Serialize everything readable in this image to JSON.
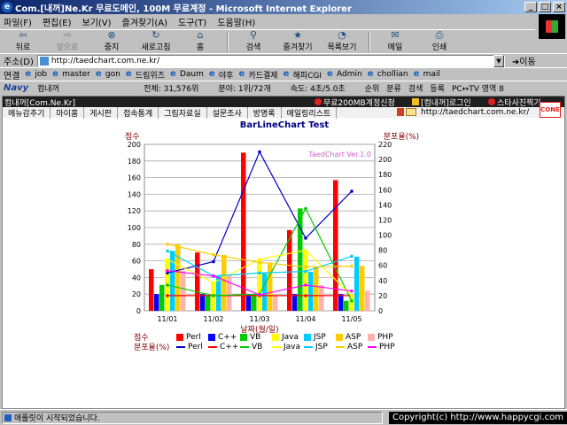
{
  "window": {
    "title": "Com.[내꺼]Ne.Kr 무료도메인, 100M 무료계정 - Microsoft Internet Explorer",
    "minimize": "_",
    "maximize": "□",
    "close": "×"
  },
  "menubar": [
    "파일(F)",
    "편집(E)",
    "보기(V)",
    "즐겨찾기(A)",
    "도구(T)",
    "도움말(H)"
  ],
  "toolbar": {
    "back": "뒤로",
    "forward": "앞으로",
    "stop": "중지",
    "refresh": "새로고침",
    "home": "홈",
    "search": "검색",
    "favorites": "즐겨찾기",
    "history": "목록보기",
    "mail": "메일",
    "print": "인쇄"
  },
  "address": {
    "label": "주소(D)",
    "url": "http://taedchart.com.ne.kr/",
    "go": "이동"
  },
  "links": {
    "label": "연결",
    "items": [
      "job",
      "master",
      "gon",
      "드림위즈",
      "Daum",
      "야후",
      "카드결제",
      "해피CGI",
      "Admin",
      "chollian",
      "mail"
    ]
  },
  "navybar": {
    "logo": "Navy",
    "site": "컴내꺼",
    "total": "전체: 31,576위",
    "field": "분야: 1위/72개",
    "speed": "속도: 4초/5.0초",
    "buttons": [
      "순위",
      "분류",
      "검색",
      "등록",
      "PC↔TV 영역 8"
    ]
  },
  "page": {
    "site_name": "컴내꺼[Com.Ne.Kr]",
    "top_right": [
      "무료200MB계정신청",
      "[컴내꺼]로그인",
      "스타사진찍기"
    ],
    "tabs": [
      "메뉴감추기",
      "마이홈",
      "게시판",
      "접속통계",
      "그림자료실",
      "설문조사",
      "방명록",
      "메일링리스트"
    ],
    "url": "http://taedchart.com.ne.kr/",
    "logo_text": "CONE"
  },
  "chart_data": {
    "type": "bar",
    "title": "BarLineChart Test",
    "subtitle": "TaedChart Ver.1.0",
    "ylabel_left": "점수",
    "ylabel_right": "분포율(%)",
    "xlabel": "날짜(월/일)",
    "ylim_left": [
      0,
      200
    ],
    "ylim_right": [
      0,
      220
    ],
    "yticks_left": [
      0,
      20,
      40,
      60,
      80,
      100,
      120,
      140,
      160,
      180,
      200
    ],
    "yticks_right": [
      0,
      20,
      40,
      60,
      80,
      100,
      120,
      140,
      160,
      180,
      200,
      220
    ],
    "categories": [
      "11/01",
      "11/02",
      "11/03",
      "11/04",
      "11/05"
    ],
    "bar_legend_header": "점수",
    "line_legend_header": "분포율(%)",
    "series": [
      {
        "name": "Perl",
        "color": "#ff0000",
        "values": [
          50,
          70,
          190,
          97,
          157
        ]
      },
      {
        "name": "C++",
        "color": "#0000ff",
        "values": [
          20,
          20,
          20,
          20,
          20
        ]
      },
      {
        "name": "VB",
        "color": "#00cc00",
        "values": [
          31,
          18,
          20,
          123,
          12
        ]
      },
      {
        "name": "Java",
        "color": "#ffff00",
        "values": [
          62,
          34,
          62,
          73,
          18
        ]
      },
      {
        "name": "JSP",
        "color": "#00ccff",
        "values": [
          72,
          42,
          45,
          47,
          65
        ]
      },
      {
        "name": "ASP",
        "color": "#ffcc00",
        "values": [
          80,
          67,
          58,
          53,
          54
        ]
      },
      {
        "name": "PHP",
        "color": "#ffb0b0",
        "values": [
          48,
          42,
          19,
          31,
          24
        ]
      }
    ],
    "lines": [
      {
        "name": "Perl",
        "color": "#0000cc",
        "values": [
          50,
          65,
          210,
          96,
          158
        ]
      },
      {
        "name": "C++",
        "color": "#ff0000",
        "values": [
          20,
          20,
          20,
          20,
          20
        ]
      },
      {
        "name": "VB",
        "color": "#00cc00",
        "values": [
          34,
          20,
          22,
          135,
          13
        ]
      },
      {
        "name": "Java",
        "color": "#ffff00",
        "values": [
          68,
          37,
          68,
          80,
          20
        ]
      },
      {
        "name": "JSP",
        "color": "#00ccff",
        "values": [
          79,
          46,
          50,
          52,
          72
        ]
      },
      {
        "name": "ASP",
        "color": "#ffcc00",
        "values": [
          88,
          74,
          64,
          58,
          59
        ]
      },
      {
        "name": "PHP",
        "color": "#ff00ff",
        "values": [
          53,
          46,
          21,
          34,
          26
        ]
      }
    ]
  },
  "status": {
    "text": "애플릿이 시작되었습니다.",
    "copyright": "Copyright(c) http://www.happycgi.com"
  }
}
